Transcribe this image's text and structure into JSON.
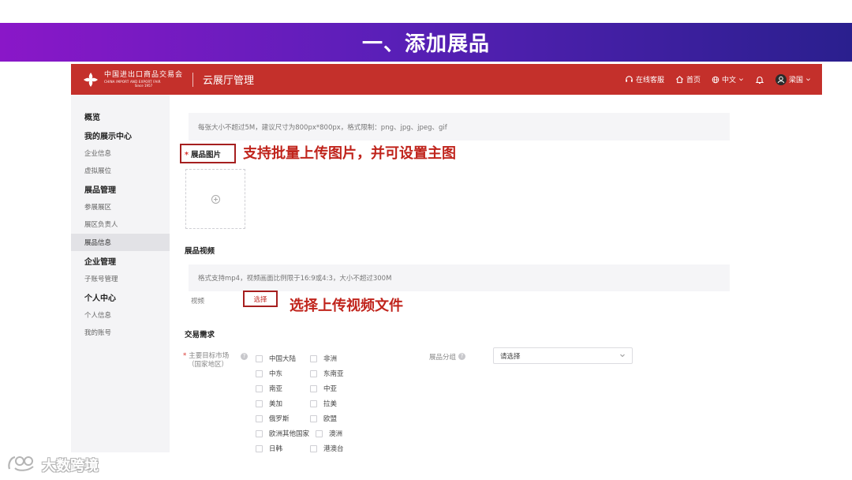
{
  "slide": {
    "title": "一、添加展品"
  },
  "header": {
    "logo_cn": "中国进出口商品交易会",
    "logo_en": "CHINA IMPORT AND EXPORT FAIR",
    "logo_since": "Since 1957",
    "app_title": "云展厅管理",
    "nav": {
      "service": "在线客服",
      "home": "首页",
      "language": "中文",
      "user": "梁国"
    },
    "color": "#c4302b"
  },
  "sidebar": {
    "items": [
      {
        "label": "概览",
        "type": "heading"
      },
      {
        "label": "我的展示中心",
        "type": "heading"
      },
      {
        "label": "企业信息",
        "type": "item"
      },
      {
        "label": "虚拟展位",
        "type": "item"
      },
      {
        "label": "展品管理",
        "type": "heading"
      },
      {
        "label": "参展展区",
        "type": "item"
      },
      {
        "label": "展区负责人",
        "type": "item"
      },
      {
        "label": "展品信息",
        "type": "item",
        "active": true
      },
      {
        "label": "企业管理",
        "type": "heading"
      },
      {
        "label": "子账号管理",
        "type": "item"
      },
      {
        "label": "个人中心",
        "type": "heading"
      },
      {
        "label": "个人信息",
        "type": "item"
      },
      {
        "label": "我的账号",
        "type": "item"
      }
    ]
  },
  "images_section": {
    "hint": "每张大小不超过5M，建议尺寸为800px*800px，格式限制：png、jpg、jpeg、gif",
    "required_mark": "*",
    "label": "展品图片",
    "annotation": "支持批量上传图片，并可设置主图"
  },
  "video_section": {
    "title": "展品视频",
    "hint": "格式支持mp4，视频画面比例限于16:9或4:3，大小不超过300M",
    "field_label": "视频",
    "select_button": "选择",
    "annotation": "选择上传视频文件"
  },
  "trade_section": {
    "title": "交易需求",
    "market_required": "*",
    "market_label_line1": "主要目标市场",
    "market_label_line2": "（国家地区）",
    "markets_left": [
      "中国大陆",
      "中东",
      "南亚",
      "美加",
      "俄罗斯",
      "欧洲其他国家",
      "日韩"
    ],
    "markets_right": [
      "非洲",
      "东南亚",
      "中亚",
      "拉美",
      "欧盟",
      "澳洲",
      "港澳台"
    ],
    "group_label": "展品分组",
    "group_placeholder": "请选择"
  },
  "watermark": {
    "text": "大数跨境"
  },
  "annotation_color": "#c0241c"
}
